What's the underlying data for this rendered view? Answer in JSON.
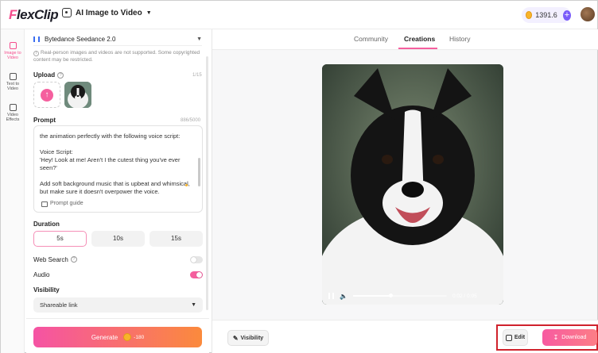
{
  "header": {
    "logo": "FlexClip",
    "tool_label": "AI Image to Video",
    "credits": "1391.6",
    "plus_glyph": "+"
  },
  "leftnav": {
    "items": [
      {
        "label": "Image to Video",
        "icon": "image-video-icon",
        "active": true
      },
      {
        "label": "Text to Video",
        "icon": "text-video-icon",
        "active": false
      },
      {
        "label": "Video Effects",
        "icon": "effects-icon",
        "active": false
      }
    ]
  },
  "panel": {
    "model": "Bytedance Seedance 2.0",
    "notice": "Real-person images and videos are not supported. Some copyrighted content may be restricted.",
    "upload_label": "Upload",
    "upload_count": "1/15",
    "prompt_label": "Prompt",
    "prompt_count": "886/5000",
    "prompt_lines": [
      "the animation perfectly with the following voice script:",
      "",
      "Voice Script:",
      "'Hey! Look at me! Aren't I the cutest thing you've ever seen?'",
      "",
      "Add soft background music that is upbeat and whimsical,",
      "but make sure it doesn't overpower the voice."
    ],
    "prompt_guide": "Prompt guide",
    "duration_label": "Duration",
    "durations": [
      "5s",
      "10s",
      "15s"
    ],
    "selected_duration": "5s",
    "web_search_label": "Web Search",
    "web_search_on": false,
    "audio_label": "Audio",
    "audio_on": true,
    "visibility_label": "Visibility",
    "visibility_value": "Shareable link",
    "generate_label": "Generate",
    "generate_cost": "-180"
  },
  "main": {
    "tabs": [
      "Community",
      "Creations",
      "History"
    ],
    "active_tab": "Creations",
    "video_time": "0:02 / 0:05",
    "video_progress": 0.4,
    "visibility_button": "Visibility",
    "edit_button": "Edit",
    "download_button": "Download"
  },
  "colors": {
    "accent": "#f55f9e",
    "highlight_box": "#d0222c"
  }
}
